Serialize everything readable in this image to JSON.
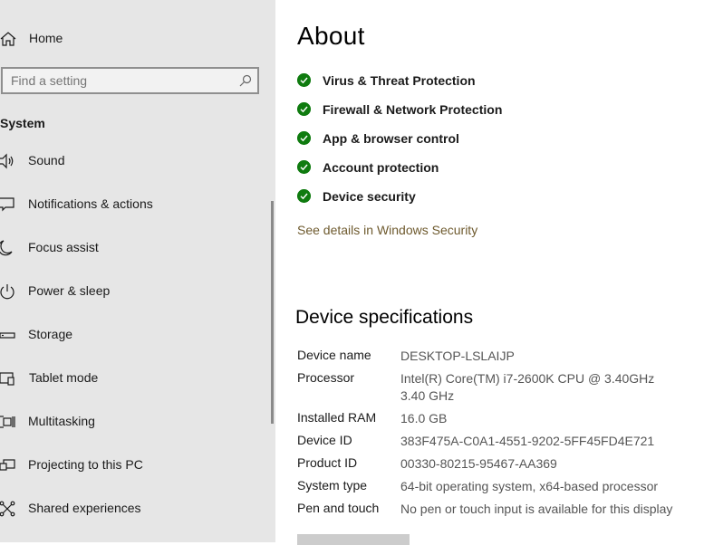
{
  "sidebar": {
    "home_label": "Home",
    "search_placeholder": "Find a setting",
    "section_title": "System",
    "items": [
      {
        "label": "Sound",
        "icon": "speaker-icon"
      },
      {
        "label": "Notifications & actions",
        "icon": "notification-icon"
      },
      {
        "label": "Focus assist",
        "icon": "moon-icon"
      },
      {
        "label": "Power & sleep",
        "icon": "power-icon"
      },
      {
        "label": "Storage",
        "icon": "storage-icon"
      },
      {
        "label": "Tablet mode",
        "icon": "tablet-icon"
      },
      {
        "label": "Multitasking",
        "icon": "multitasking-icon"
      },
      {
        "label": "Projecting to this PC",
        "icon": "projecting-icon"
      },
      {
        "label": "Shared experiences",
        "icon": "shared-experiences-icon"
      }
    ]
  },
  "main": {
    "title": "About",
    "protections": [
      {
        "label": "Virus & Threat Protection"
      },
      {
        "label": "Firewall & Network Protection"
      },
      {
        "label": "App & browser control"
      },
      {
        "label": "Account protection"
      },
      {
        "label": "Device security"
      }
    ],
    "details_link": "See details in Windows Security",
    "device_specs_title": "Device specifications",
    "specs": [
      {
        "label": "Device name",
        "value": "DESKTOP-LSLAIJP"
      },
      {
        "label": "Processor",
        "value": "Intel(R) Core(TM) i7-2600K CPU @ 3.40GHz   3.40 GHz"
      },
      {
        "label": "Installed RAM",
        "value": "16.0 GB"
      },
      {
        "label": "Device ID",
        "value": "383F475A-C0A1-4551-9202-5FF45FD4E721"
      },
      {
        "label": "Product ID",
        "value": "00330-80215-95467-AA369"
      },
      {
        "label": "System type",
        "value": "64-bit operating system, x64-based processor"
      },
      {
        "label": "Pen and touch",
        "value": "No pen or touch input is available for this display"
      }
    ]
  },
  "colors": {
    "sidebar_bg": "#e6e6e6",
    "check_green": "#0f7b0f",
    "link": "#6e5a2e"
  }
}
